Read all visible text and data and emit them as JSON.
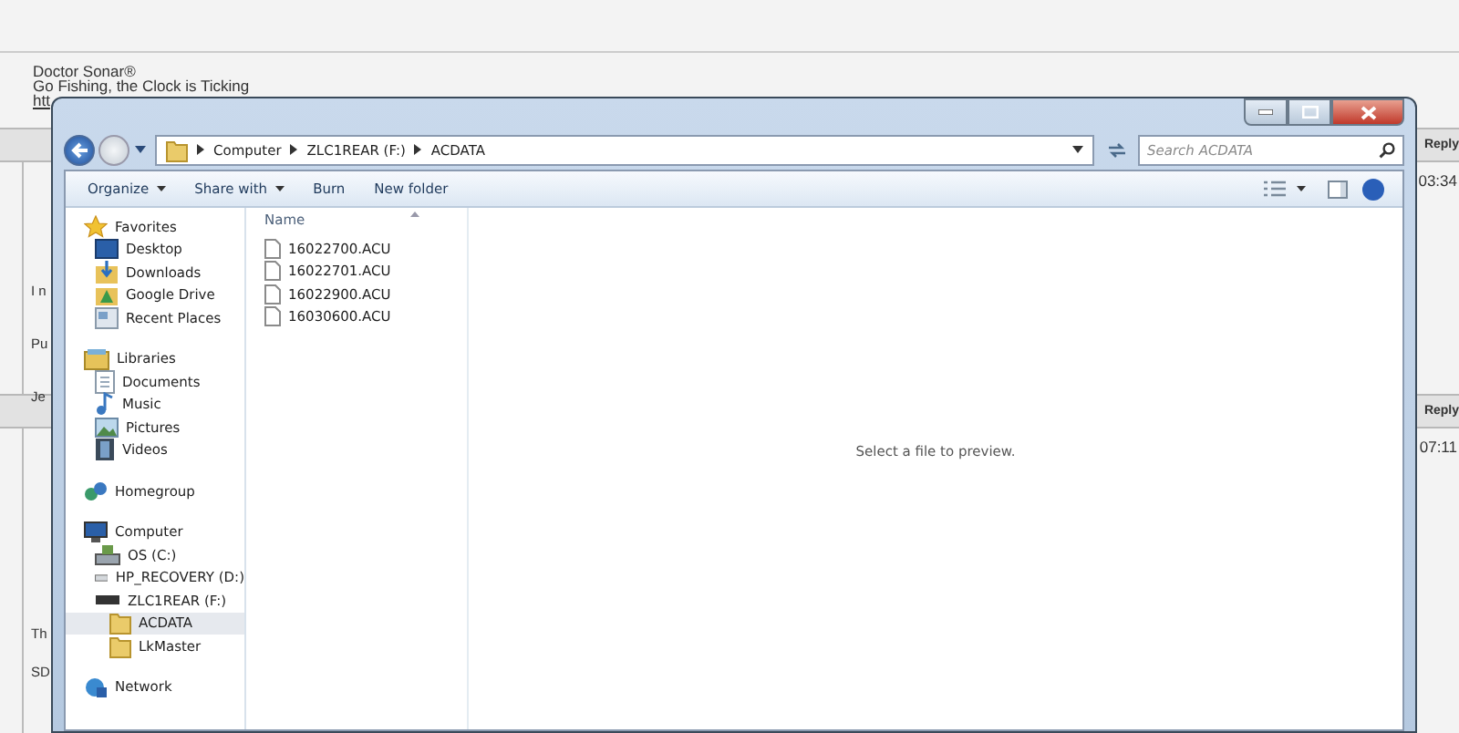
{
  "background_page": {
    "signature": {
      "name": "Doctor Sonar®",
      "tagline": "Go Fishing, the Clock is Ticking",
      "link": "htt"
    },
    "posts": [
      {
        "action": "Reply",
        "time": "03:34",
        "fragments": [
          "I n",
          "Pu",
          "Je"
        ]
      },
      {
        "action": "Reply",
        "time": "07:11",
        "fragments": [
          "Th",
          "SD"
        ]
      }
    ]
  },
  "window": {
    "breadcrumb": [
      "Computer",
      "ZLC1REAR (F:)",
      "ACDATA"
    ],
    "search": {
      "placeholder": "Search ACDATA"
    },
    "toolbar": [
      {
        "label": "Organize",
        "menu": true
      },
      {
        "label": "Share with",
        "menu": true
      },
      {
        "label": "Burn",
        "menu": false
      },
      {
        "label": "New folder",
        "menu": false
      }
    ],
    "nav": [
      {
        "label": "Favorites",
        "kind": "star",
        "children": [
          {
            "label": "Desktop",
            "kind": "desktop",
            "selected": false
          },
          {
            "label": "Downloads",
            "kind": "downloads",
            "selected": false
          },
          {
            "label": "Google Drive",
            "kind": "gdrive",
            "selected": false
          },
          {
            "label": "Recent Places",
            "kind": "recent",
            "selected": false
          }
        ]
      },
      {
        "label": "Libraries",
        "kind": "library",
        "children": [
          {
            "label": "Documents",
            "kind": "documents",
            "selected": false
          },
          {
            "label": "Music",
            "kind": "music",
            "selected": false
          },
          {
            "label": "Pictures",
            "kind": "pictures",
            "selected": false
          },
          {
            "label": "Videos",
            "kind": "videos",
            "selected": false
          }
        ]
      },
      {
        "label": "Homegroup",
        "kind": "homegroup"
      },
      {
        "label": "Computer",
        "kind": "computer",
        "children": [
          {
            "label": "OS (C:)",
            "kind": "osdrive",
            "selected": false
          },
          {
            "label": "HP_RECOVERY (D:)",
            "kind": "hdd",
            "selected": false
          },
          {
            "label": "ZLC1REAR (F:)",
            "kind": "usb",
            "selected": false,
            "children": [
              {
                "label": "ACDATA",
                "kind": "folder",
                "selected": true
              },
              {
                "label": "LkMaster",
                "kind": "folder",
                "selected": false
              }
            ]
          }
        ]
      },
      {
        "label": "Network",
        "kind": "network"
      }
    ],
    "columns": [
      "Name"
    ],
    "files": [
      "16022700.ACU",
      "16022701.ACU",
      "16022900.ACU",
      "16030600.ACU"
    ],
    "preview": "Select a file to preview."
  }
}
